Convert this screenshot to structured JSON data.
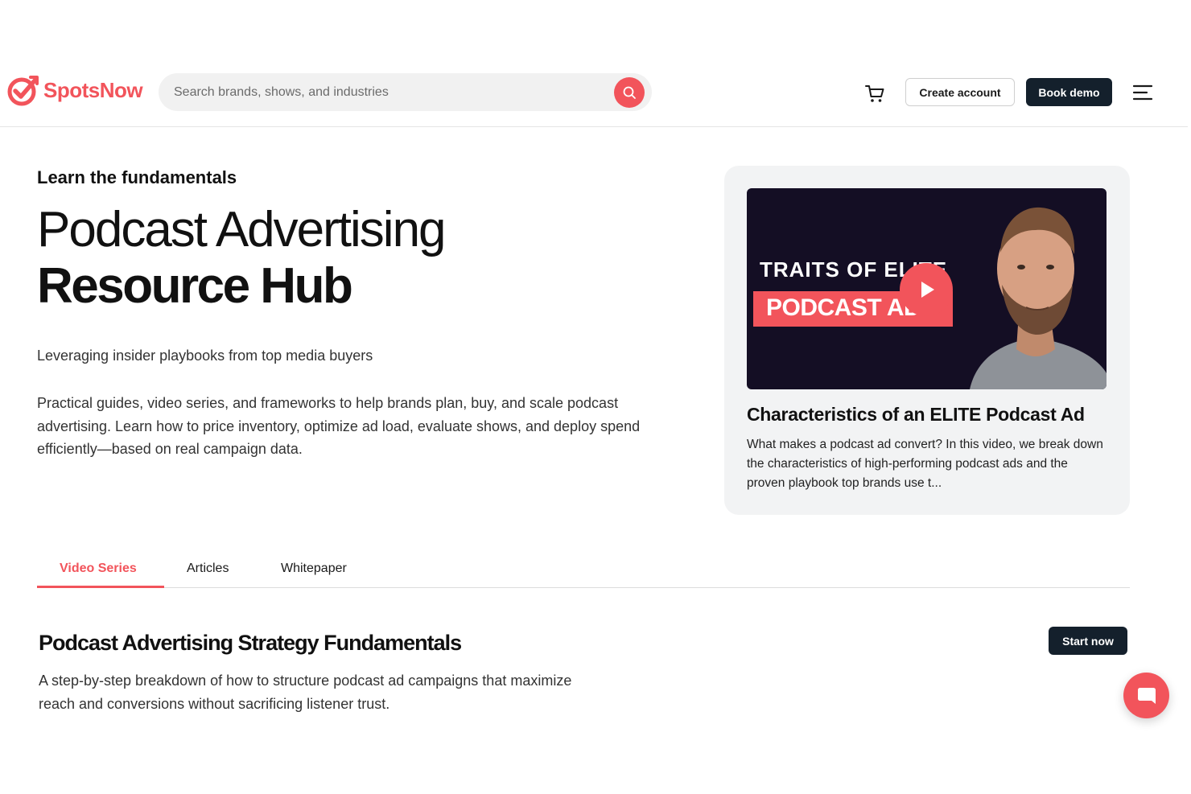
{
  "brand": {
    "name": "SpotsNow",
    "accent": "#f2545b",
    "dark": "#14202c"
  },
  "header": {
    "search_placeholder": "Search brands, shows, and industries",
    "search_icon": "search-icon",
    "cart_icon": "cart-icon",
    "create_account_label": "Create account",
    "book_demo_label": "Book demo",
    "menu_icon": "hamburger-menu-icon"
  },
  "hero": {
    "eyebrow": "Learn the fundamentals",
    "title_line1": "Podcast Advertising",
    "title_line2": "Resource Hub",
    "subtitle": "Leveraging insider playbooks from top media buyers",
    "description": "Practical guides, video series, and frameworks to help brands plan, buy, and scale podcast advertising. Learn how to price inventory, optimize ad load, evaluate shows, and deploy spend efficiently—based on real campaign data."
  },
  "featured_video": {
    "thumb_line1": "TRAITS OF ELITE",
    "thumb_line2": "PODCAST ADS",
    "play_icon": "play-icon",
    "title": "Characteristics of an ELITE Podcast Ad",
    "description": "What makes a podcast ad convert? In this video, we break down the characteristics of high-performing podcast ads and the proven playbook top brands use t..."
  },
  "tabs": [
    {
      "label": "Video Series",
      "active": true
    },
    {
      "label": "Articles",
      "active": false
    },
    {
      "label": "Whitepaper",
      "active": false
    }
  ],
  "section": {
    "title": "Podcast Advertising Strategy Fundamentals",
    "description": "A step-by-step breakdown of how to structure podcast ad campaigns that maximize reach and conversions without sacrificing listener trust.",
    "start_label": "Start now"
  },
  "chat_icon": "chat-bubble-icon"
}
